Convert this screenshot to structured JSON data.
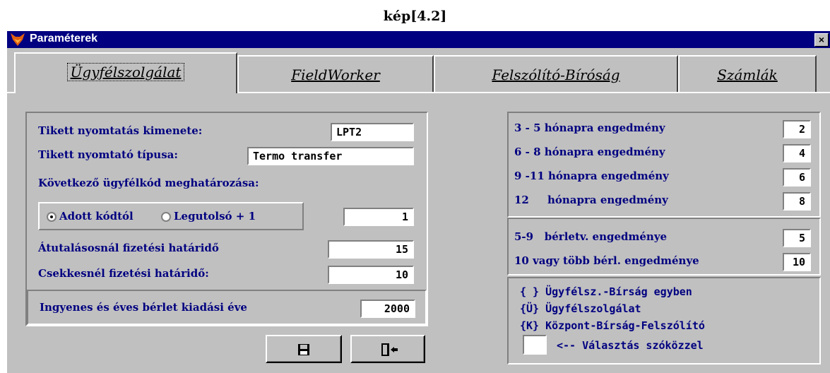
{
  "caption": "kép[4.2]",
  "window": {
    "title": "Paraméterek",
    "close": "×"
  },
  "tabs": [
    {
      "label": "Ügyfélszolgálat",
      "active": true
    },
    {
      "label": "FieldWorker"
    },
    {
      "label": "Felszólító-Bíróság"
    },
    {
      "label": "Számlák"
    }
  ],
  "left": {
    "ticket_output_label": "Tikett nyomtatás kimenete:",
    "ticket_output_value": "LPT2",
    "ticket_type_label": "Tikett nyomtató típusa:",
    "ticket_type_value": "Termo transfer",
    "next_code_label": "Következő ügyfélkód meghatározása:",
    "radio_given": "Adott kódtól",
    "radio_last": "Legutolsó + 1",
    "next_code_value": "1",
    "transfer_label": "Átutalásosnál fizetési határidő",
    "transfer_value": "15",
    "cheque_label": "Csekkesnél fizetési határidő:",
    "cheque_value": "10",
    "free_year_label": "Ingyenes és éves bérlet kiadási éve",
    "free_year_value": "2000"
  },
  "right": {
    "discounts": [
      {
        "label": "3 - 5  hónapra engedmény",
        "value": "2"
      },
      {
        "label": "6 - 8  hónapra engedmény",
        "value": "4"
      },
      {
        "label": "9 -11 hónapra engedmény",
        "value": "6"
      },
      {
        "label": "12     hónapra engedmény",
        "value": "8"
      }
    ],
    "contracts": [
      {
        "label": "5-9   bérletv. engedménye",
        "value": "5"
      },
      {
        "label": "10 vagy több bérl. engedménye",
        "value": "10"
      }
    ],
    "legend": [
      "{ } Ügyfélsz.-Bírság egyben",
      "{Ü} Ügyfélszolgálat",
      "{K} Központ-Bírság-Felszólító"
    ],
    "choose_label": "<-- Választás szóközzel"
  },
  "colors": {
    "accent": "#000080",
    "face": "#c0c0c0"
  },
  "icons": {
    "save": "floppy-disk-icon",
    "exit": "door-exit-icon"
  }
}
